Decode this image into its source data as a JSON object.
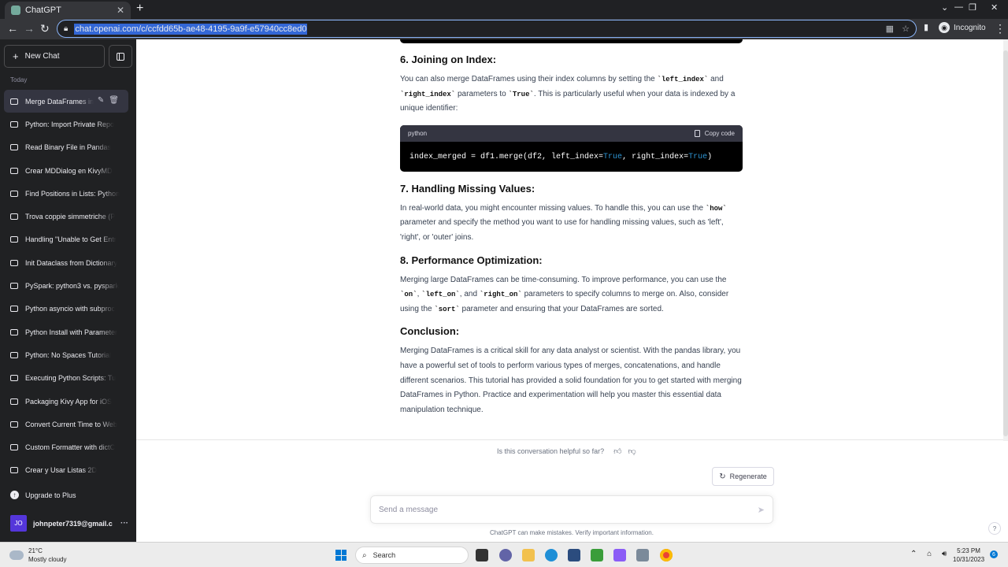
{
  "browser": {
    "tab_title": "ChatGPT",
    "url": "chat.openai.com/c/ccfdd65b-ae48-4195-9a9f-e57940cc8ed0",
    "profile_label": "Incognito"
  },
  "sidebar": {
    "new_chat_label": "New Chat",
    "section_label": "Today",
    "conversations": [
      {
        "label": "Merge DataFrames in"
      },
      {
        "label": "Python: Import Private Repo"
      },
      {
        "label": "Read Binary File in Pandas"
      },
      {
        "label": "Crear MDDialog en KivyMD"
      },
      {
        "label": "Find Positions in Lists: Python"
      },
      {
        "label": "Trova coppie simmetriche (P"
      },
      {
        "label": "Handling \"Unable to Get Entr"
      },
      {
        "label": "Init Dataclass from Dictionary"
      },
      {
        "label": "PySpark: python3 vs. pyspark"
      },
      {
        "label": "Python asyncio with subproc"
      },
      {
        "label": "Python Install with Parameter"
      },
      {
        "label": "Python: No Spaces Tutorial"
      },
      {
        "label": "Executing Python Scripts: Tu"
      },
      {
        "label": "Packaging Kivy App for iOS"
      },
      {
        "label": "Convert Current Time to Web"
      },
      {
        "label": "Custom Formatter with dictC"
      },
      {
        "label": "Crear y Usar Listas 2D"
      }
    ],
    "upgrade_label": "Upgrade to Plus",
    "user_initials": "JO",
    "user_email": "johnpeter7319@gmail.c"
  },
  "content": {
    "s6_title": "6. Joining on Index:",
    "s6_p_a": "You can also merge DataFrames using their index columns by setting the ",
    "s6_c1": "`left_index`",
    "s6_p_b": " and ",
    "s6_c2": "`right_index`",
    "s6_p_c": " parameters to ",
    "s6_c3": "`True`",
    "s6_p_d": ". This is particularly useful when your data is indexed by a unique identifier:",
    "code_lang": "python",
    "copy_label": "Copy code",
    "code_a": "index_merged = df1.merge(df2, left_index=",
    "code_kw1": "True",
    "code_b": ", right_index=",
    "code_kw2": "True",
    "code_c": ")",
    "s7_title": "7. Handling Missing Values:",
    "s7_p_a": "In real-world data, you might encounter missing values. To handle this, you can use the ",
    "s7_c1": "`how`",
    "s7_p_b": " parameter and specify the method you want to use for handling missing values, such as 'left', 'right', or 'outer' joins.",
    "s8_title": "8. Performance Optimization:",
    "s8_p_a": "Merging large DataFrames can be time-consuming. To improve performance, you can use the ",
    "s8_c1": "`on`",
    "s8_p_b": ", ",
    "s8_c2": "`left_on`",
    "s8_p_c": ", and ",
    "s8_c3": "`right_on`",
    "s8_p_d": " parameters to specify columns to merge on. Also, consider using the ",
    "s8_c4": "`sort`",
    "s8_p_e": " parameter and ensuring that your DataFrames are sorted.",
    "conc_title": "Conclusion:",
    "conc_p": "Merging DataFrames is a critical skill for any data analyst or scientist. With the pandas library, you have a powerful set of tools to perform various types of merges, concatenations, and handle different scenarios. This tutorial has provided a solid foundation for you to get started with merging DataFrames in Python. Practice and experimentation will help you master this essential data manipulation technique."
  },
  "footer": {
    "feedback_question": "Is this conversation helpful so far?",
    "regenerate_label": "Regenerate",
    "composer_placeholder": "Send a message",
    "disclaimer": "ChatGPT can make mistakes. Verify important information.",
    "help_label": "?"
  },
  "taskbar": {
    "temperature": "21°C",
    "weather": "Mostly cloudy",
    "search_label": "Search",
    "time": "5:23 PM",
    "date": "10/31/2023",
    "notification_count": "6"
  }
}
